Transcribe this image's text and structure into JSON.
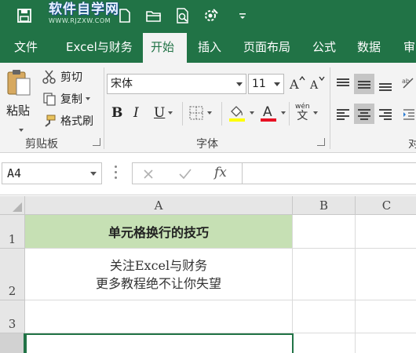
{
  "watermark": {
    "main": "软件自学网",
    "sub": "WWW.RJZXW.COM"
  },
  "colors": {
    "brand": "#217346",
    "header_fill": "#c6e0b4",
    "font_color_bar": "#e81123",
    "fill_color_bar": "#ffff00"
  },
  "tabs": [
    {
      "label": "文件"
    },
    {
      "label": "Excel与财务"
    },
    {
      "label": "开始"
    },
    {
      "label": "插入"
    },
    {
      "label": "页面布局"
    },
    {
      "label": "公式"
    },
    {
      "label": "数据"
    },
    {
      "label": "审"
    }
  ],
  "ribbon": {
    "clipboard": {
      "paste": "粘贴",
      "cut": "剪切",
      "copy": "复制",
      "format_painter": "格式刷",
      "group_label": "剪贴板"
    },
    "font": {
      "name": "宋体",
      "size": "11",
      "bold": "B",
      "italic": "I",
      "underline": "U",
      "font_color_letter": "A",
      "phonetic": "wén",
      "group_label": "字体"
    },
    "alignment": {
      "group_label_partial": "对"
    }
  },
  "formula_bar": {
    "name_box": "A4",
    "fx": "fx",
    "content": ""
  },
  "grid": {
    "columns": [
      "A",
      "B",
      "C"
    ],
    "rows": [
      "1",
      "2",
      "3",
      ""
    ],
    "cells": {
      "A1": "单元格换行的技巧",
      "A2_line1": "关注Excel与财务",
      "A2_line2": "更多教程绝不让你失望"
    },
    "selected_cell": "A4"
  }
}
